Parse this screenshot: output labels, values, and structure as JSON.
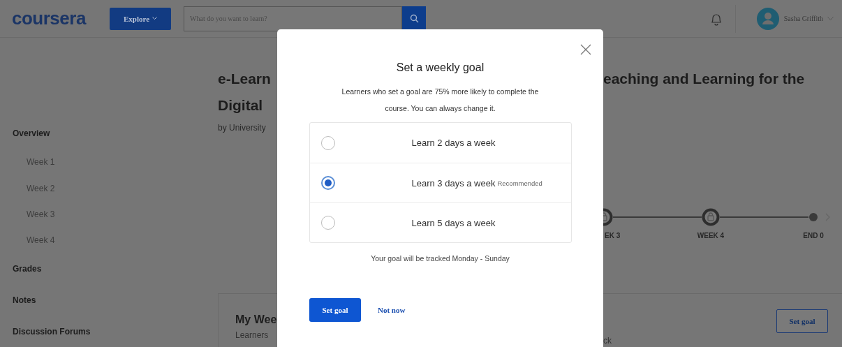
{
  "header": {
    "logo": "coursera",
    "explore_button": "Explore",
    "search": {
      "placeholder": "What do you want to learn?"
    },
    "user_name": "Sasha Griffith"
  },
  "sidebar": {
    "items": [
      {
        "label": "Overview",
        "children": [
          {
            "label": "Week 1"
          },
          {
            "label": "Week 2"
          },
          {
            "label": "Week 3"
          },
          {
            "label": "Week 4"
          }
        ]
      },
      {
        "label": "Grades"
      },
      {
        "label": "Notes"
      },
      {
        "label": "Discussion Forums"
      }
    ]
  },
  "course": {
    "title_left": [
      "e-Learn",
      "Digital"
    ],
    "title_right": "eaching and Learning for the",
    "byline": "by University"
  },
  "timeline": {
    "nodes": [
      {
        "label": "EK 3",
        "kind": "lock"
      },
      {
        "label": "WEEK 4",
        "kind": "lock"
      },
      {
        "label": "END 0",
        "kind": "dot"
      }
    ]
  },
  "weekly_card": {
    "title": "My Wee",
    "text_left": "Learners",
    "text_right": "ck",
    "button": "Set goal"
  },
  "dialog": {
    "title": "Set a weekly goal",
    "description": "Learners who set a goal are 75% more likely to complete the course. You can always change it.",
    "options": [
      {
        "label": "Learn 2 days a week",
        "selected": false
      },
      {
        "label": "Learn 3 days a week",
        "badge": "Recommended",
        "selected": true
      },
      {
        "label": "Learn 5 days a week",
        "selected": false
      }
    ],
    "note": "Your goal will be tracked Monday - Sunday",
    "primary_button": "Set goal",
    "secondary_button": "Not now"
  }
}
